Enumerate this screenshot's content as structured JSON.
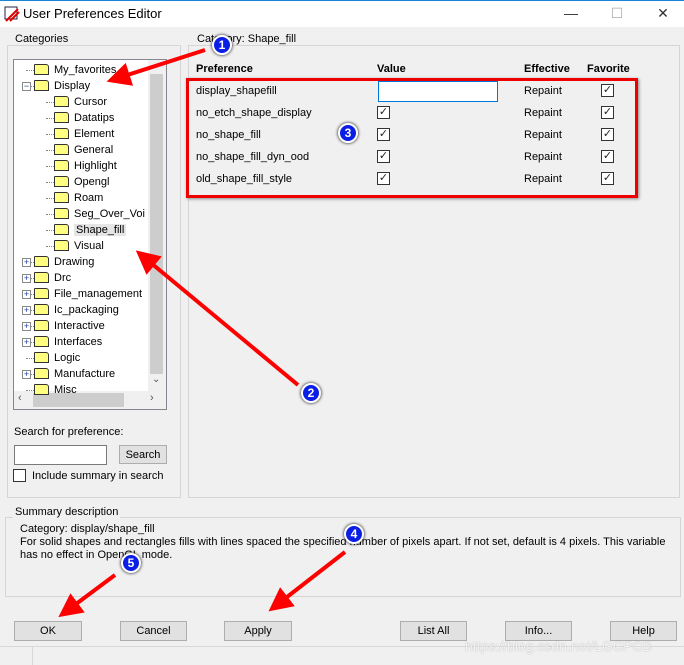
{
  "window": {
    "title": "User Preferences Editor",
    "minimize": "—",
    "maximize": "☐",
    "close": "✕"
  },
  "categories": {
    "label": "Categories",
    "items": [
      {
        "label": "My_favorites",
        "level": 0,
        "expander": ""
      },
      {
        "label": "Display",
        "level": 0,
        "expander": "−"
      },
      {
        "label": "Cursor",
        "level": 1
      },
      {
        "label": "Datatips",
        "level": 1
      },
      {
        "label": "Element",
        "level": 1
      },
      {
        "label": "General",
        "level": 1
      },
      {
        "label": "Highlight",
        "level": 1
      },
      {
        "label": "Opengl",
        "level": 1
      },
      {
        "label": "Roam",
        "level": 1
      },
      {
        "label": "Seg_Over_Voi",
        "level": 1
      },
      {
        "label": "Shape_fill",
        "level": 1,
        "selected": true
      },
      {
        "label": "Visual",
        "level": 1
      },
      {
        "label": "Drawing",
        "level": 0,
        "expander": "+"
      },
      {
        "label": "Drc",
        "level": 0,
        "expander": "+"
      },
      {
        "label": "File_management",
        "level": 0,
        "expander": "+"
      },
      {
        "label": "Ic_packaging",
        "level": 0,
        "expander": "+"
      },
      {
        "label": "Interactive",
        "level": 0,
        "expander": "+"
      },
      {
        "label": "Interfaces",
        "level": 0,
        "expander": "+"
      },
      {
        "label": "Logic",
        "level": 0,
        "expander": ""
      },
      {
        "label": "Manufacture",
        "level": 0,
        "expander": "+"
      },
      {
        "label": "Misc",
        "level": 0,
        "expander": ""
      }
    ],
    "search_label": "Search for preference:",
    "search_value": "",
    "search_button": "Search",
    "include_summary_label": "Include summary in search",
    "include_summary_checked": false
  },
  "prefs": {
    "group_label": "Category:  Shape_fill",
    "headers": {
      "preference": "Preference",
      "value": "Value",
      "effective": "Effective",
      "favorite": "Favorite"
    },
    "rows": [
      {
        "name": "display_shapefill",
        "value": "",
        "type": "text",
        "effective": "Repaint",
        "favorite": true
      },
      {
        "name": "no_etch_shape_display",
        "value": true,
        "type": "check",
        "effective": "Repaint",
        "favorite": true
      },
      {
        "name": "no_shape_fill",
        "value": true,
        "type": "check",
        "effective": "Repaint",
        "favorite": true
      },
      {
        "name": "no_shape_fill_dyn_ood",
        "value": true,
        "type": "check",
        "effective": "Repaint",
        "favorite": true
      },
      {
        "name": "old_shape_fill_style",
        "value": true,
        "type": "check",
        "effective": "Repaint",
        "favorite": true
      }
    ]
  },
  "summary": {
    "label": "Summary description",
    "line1": "Category: display/shape_fill",
    "line2": "For solid shapes and rectangles fills with lines spaced the specified number of pixels apart. If not set, default is 4 pixels. This variable",
    "line3": "has no effect in OpenGL mode."
  },
  "buttons": {
    "ok": "OK",
    "cancel": "Cancel",
    "apply": "Apply",
    "list_all": "List All",
    "info": "Info...",
    "help": "Help"
  },
  "watermark": "https://blog.csdn.net/LGCPCB",
  "annotations": {
    "badges": [
      "1",
      "2",
      "3",
      "4",
      "5"
    ],
    "color": "#ff0000",
    "badge_color": "#0a1ee6"
  }
}
